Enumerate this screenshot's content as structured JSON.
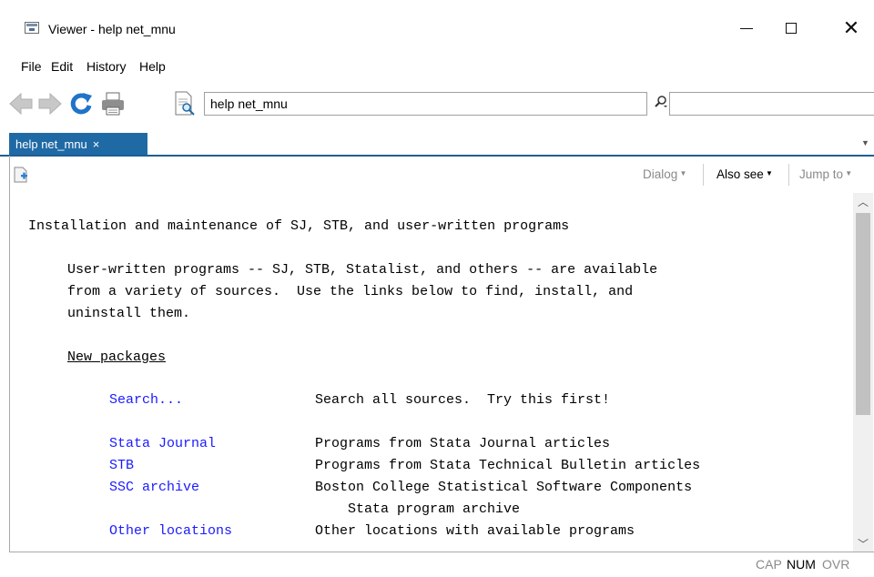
{
  "window": {
    "title": "Viewer - help net_mnu"
  },
  "menu": [
    {
      "label": "File"
    },
    {
      "label": "Edit"
    },
    {
      "label": "History"
    },
    {
      "label": "Help"
    }
  ],
  "toolbar": {
    "address_value": "help net_mnu",
    "icons": [
      "back-arrow-icon",
      "forward-arrow-icon",
      "refresh-icon",
      "print-icon",
      "find-document-icon",
      "search-icon"
    ]
  },
  "tab": {
    "label": "help net_mnu",
    "close": "×"
  },
  "subbar": {
    "dialog": "Dialog",
    "also_see": "Also see",
    "jump_to": "Jump to"
  },
  "content": {
    "heading": "Installation and maintenance of SJ, STB, and user-written programs",
    "para1": "User-written programs -- SJ, STB, Statalist, and others -- are available",
    "para2": "from a variety of sources.  Use the links below to find, install, and",
    "para3": "uninstall them.",
    "section": "New packages",
    "rows": [
      {
        "link": "Search...",
        "desc": "Search all sources.  Try this first!"
      },
      {
        "link": "Stata Journal",
        "desc": "Programs from Stata Journal articles"
      },
      {
        "link": "STB",
        "desc": "Programs from Stata Technical Bulletin articles"
      },
      {
        "link": "SSC archive",
        "desc": "Boston College Statistical Software Components"
      },
      {
        "link": "Other locations",
        "desc": "Other locations with available programs"
      }
    ],
    "ssc_cont": "Stata program archive"
  },
  "status": {
    "cap": "CAP",
    "num": "NUM",
    "ovr": "OVR"
  },
  "colors": {
    "tab_bg": "#1f6aa5",
    "link": "#1a1aff",
    "status_active": "#000000",
    "status_inactive": "#8a8a8a"
  }
}
